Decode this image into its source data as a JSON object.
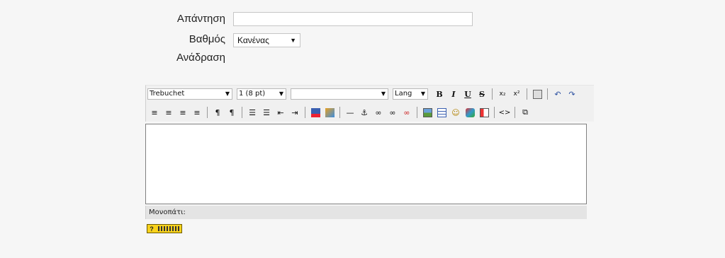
{
  "form": {
    "answer_label": "Απάντηση",
    "answer_value": "",
    "grade_label": "Βαθμός",
    "grade_value": "Κανένας",
    "feedback_label": "Ανάδραση"
  },
  "editor": {
    "font_family": "Trebuchet",
    "font_size": "1 (8 pt)",
    "style": "",
    "lang": "Lang",
    "path_label": "Μονοπάτι:"
  },
  "icons": {
    "bold": "B",
    "italic": "I",
    "underline": "U",
    "strike": "S",
    "subscript": "x₂",
    "superscript": "x²",
    "undo": "↶",
    "redo": "↷",
    "align_left": "≡",
    "align_center": "≡",
    "align_right": "≡",
    "justify": "≡",
    "ltr": "¶",
    "rtl": "¶",
    "ordered_list": "☰",
    "unordered_list": "☰",
    "outdent": "⇤",
    "indent": "⇥",
    "hr": "—",
    "anchor": "⚓",
    "link": "∞",
    "unlink": "∞",
    "nolink": "∞",
    "smiley": "☺",
    "source": "<>",
    "fullscreen": "⧉"
  },
  "colors": {
    "background": "#f6f6f6",
    "help_badge": "#f8d21c"
  }
}
